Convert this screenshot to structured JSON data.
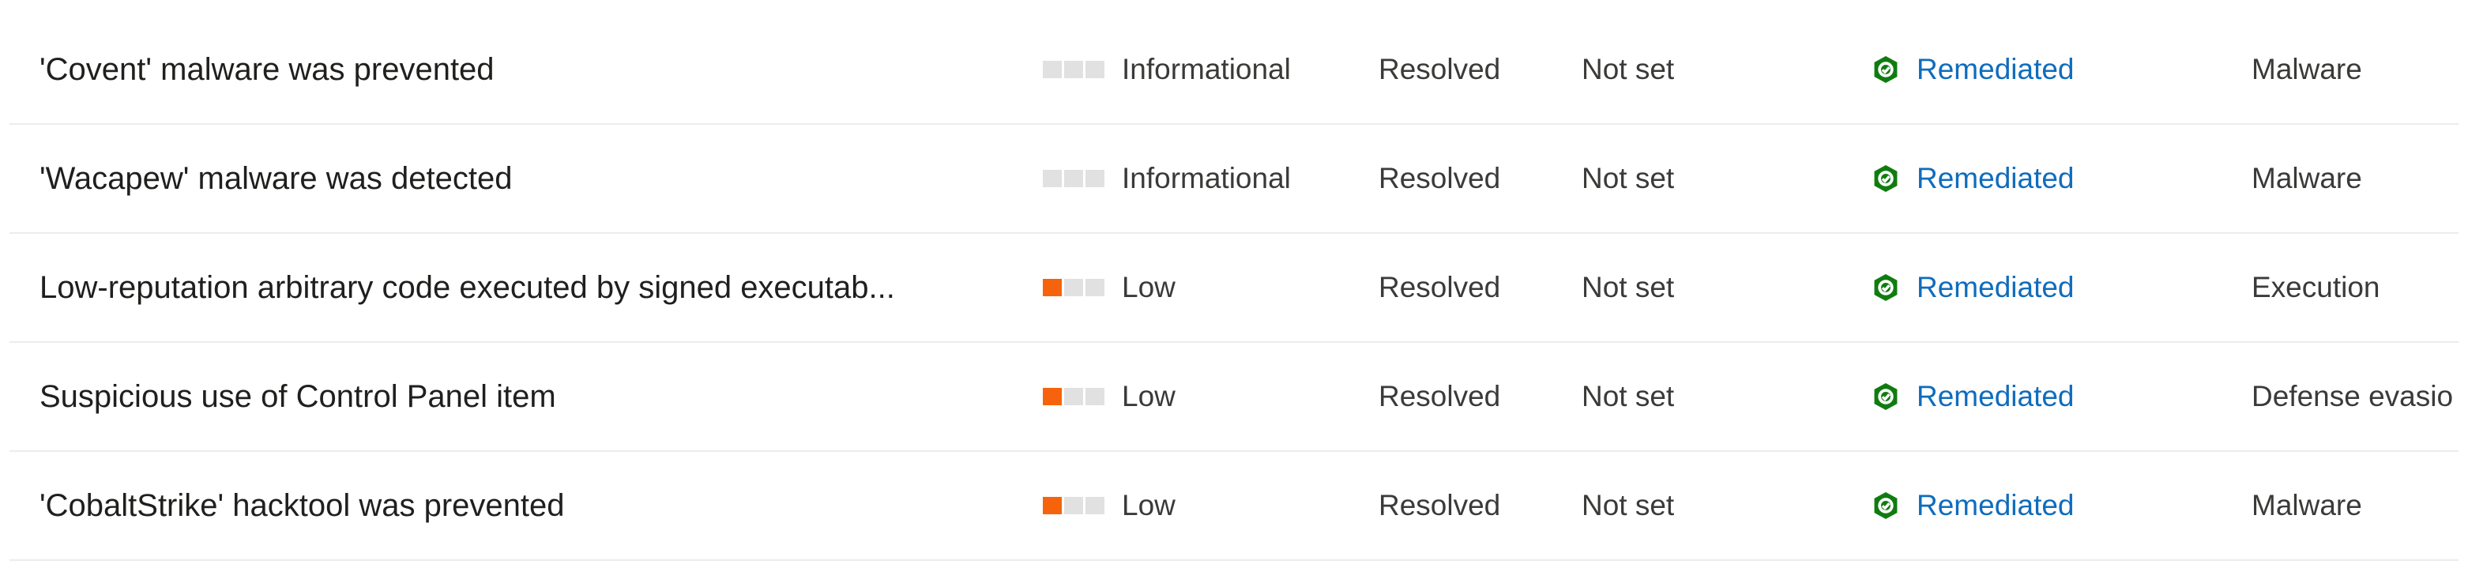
{
  "colors": {
    "severity_active": "#f7630c",
    "severity_inactive": "#e1e1e1",
    "remediated_icon": "#107c10",
    "link": "#0f6cbd",
    "row_divider": "#ececec"
  },
  "icons": {
    "severity": "severity-bars-icon",
    "remediated": "shield-check-icon"
  },
  "alerts": [
    {
      "title": "'Covent' malware was prevented",
      "severity": "Informational",
      "severity_level": 0,
      "status": "Resolved",
      "classification": "Not set",
      "investigation_state": "Remediated",
      "category": "Malware"
    },
    {
      "title": "'Wacapew' malware was detected",
      "severity": "Informational",
      "severity_level": 0,
      "status": "Resolved",
      "classification": "Not set",
      "investigation_state": "Remediated",
      "category": "Malware"
    },
    {
      "title": "Low-reputation arbitrary code executed by signed executab...",
      "severity": "Low",
      "severity_level": 1,
      "status": "Resolved",
      "classification": "Not set",
      "investigation_state": "Remediated",
      "category": "Execution"
    },
    {
      "title": "Suspicious use of Control Panel item",
      "severity": "Low",
      "severity_level": 1,
      "status": "Resolved",
      "classification": "Not set",
      "investigation_state": "Remediated",
      "category": "Defense evasio"
    },
    {
      "title": "'CobaltStrike' hacktool was prevented",
      "severity": "Low",
      "severity_level": 1,
      "status": "Resolved",
      "classification": "Not set",
      "investigation_state": "Remediated",
      "category": "Malware"
    }
  ]
}
